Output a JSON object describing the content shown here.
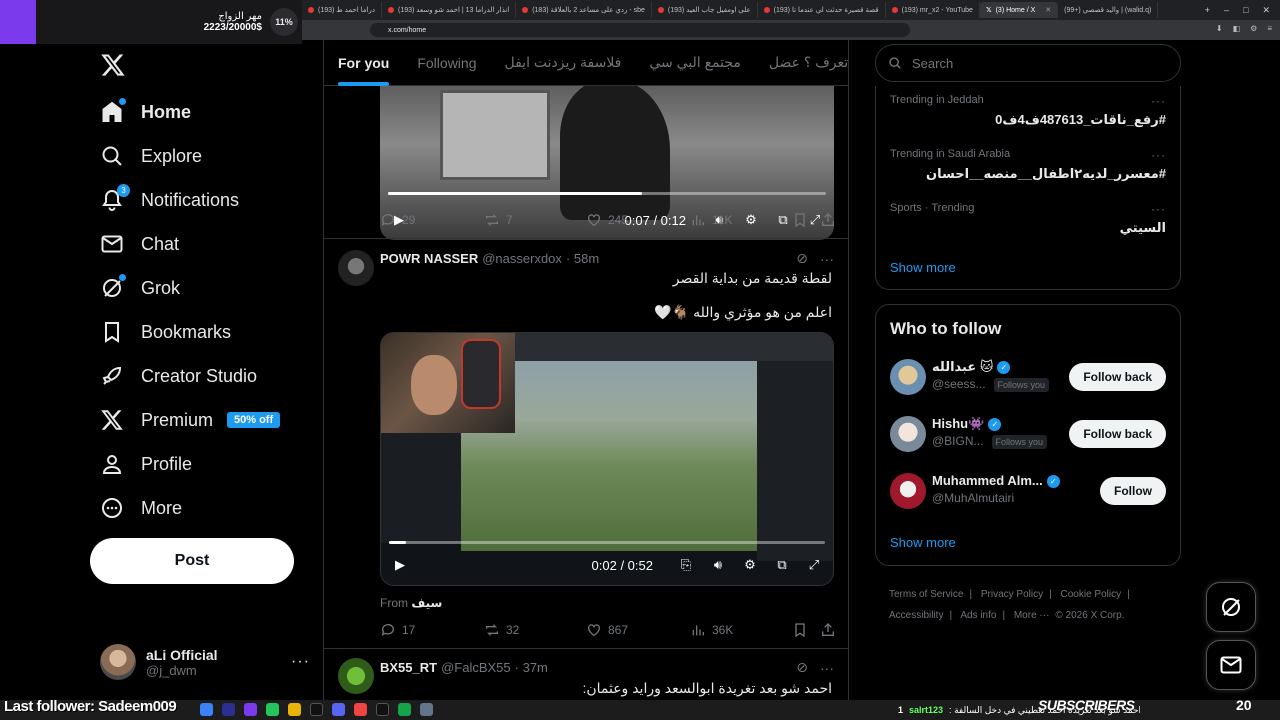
{
  "browser": {
    "tabs": [
      {
        "label": "(193) دراما احمد ط"
      },
      {
        "label": "(193) انذار الدراما 13 | احمد شو وسعد"
      },
      {
        "label": "(183) ردي على مساعد 2 بالعلاقة - sbe"
      },
      {
        "label": "(193) على اومفيل جاب العيد"
      },
      {
        "label": "(193) قصة قصيرة حدثت لي عندما تا"
      },
      {
        "label": "(193) mr_x2 - YouTube"
      },
      {
        "label": "(3) Home / X"
      },
      {
        "label": "(99+) واليد قصصي | (walid.q)"
      }
    ],
    "active_tab": "(3) Home / X",
    "url": "x.com/home"
  },
  "stream": {
    "donation_title": "مهر الزواج",
    "donation_amount": "2223/20000$",
    "donation_pct": "11%",
    "last_follower": "Last follower: Sadeem009",
    "ticker_user": "salrt123",
    "ticker_text": ": احمد شو بعد تغريدة احمد تعطيني في دخل السالفة",
    "ticker_num": "1",
    "subs_label": "SUBSCRIBERS",
    "subs_count": "20"
  },
  "nav": {
    "items": [
      {
        "label": "Home",
        "icon": "home-icon"
      },
      {
        "label": "Explore",
        "icon": "search-icon"
      },
      {
        "label": "Notifications",
        "icon": "bell-icon",
        "badge": "3"
      },
      {
        "label": "Chat",
        "icon": "mail-icon"
      },
      {
        "label": "Grok",
        "icon": "grok-icon"
      },
      {
        "label": "Bookmarks",
        "icon": "bookmark-icon"
      },
      {
        "label": "Creator Studio",
        "icon": "rocket-icon"
      },
      {
        "label": "Premium",
        "icon": "x-logo-icon",
        "pill": "50% off"
      },
      {
        "label": "Profile",
        "icon": "person-icon"
      },
      {
        "label": "More",
        "icon": "more-circle-icon"
      }
    ],
    "post_label": "Post",
    "account": {
      "name": "aLi Official",
      "handle": "@j_dwm"
    }
  },
  "feed": {
    "tabs": [
      "For you",
      "Following",
      "فلاسفة ريزدنت ايفل",
      "مجتمع البي سي",
      "هنا راح تعرف ؟ عضل"
    ],
    "tweet1": {
      "video_time": "0:07 / 0:12",
      "video_progress": 0.58,
      "replies": "29",
      "reposts": "7",
      "likes": "245",
      "views": "11K"
    },
    "tweet2": {
      "name": "POWR NASSER",
      "handle": "@nasserxdox",
      "time": "· 58m",
      "line1": "لقطة قديمة من بداية القصر",
      "line2": "اعلم من هو مؤثري والله 🐐🤍",
      "video_time": "0:02 / 0:52",
      "video_progress": 0.04,
      "from_label": "From",
      "from_name": "سيف",
      "replies": "17",
      "reposts": "32",
      "likes": "867",
      "views": "36K"
    },
    "tweet3": {
      "name": "BX55_RT",
      "handle": "@FalcBX55",
      "time": "· 37m",
      "line1": "احمد شو بعد تغريدة ابوالسعد ورايد وعثمان:"
    }
  },
  "sidebar": {
    "search_placeholder": "Search",
    "trends": [
      {
        "meta": "Trending in Jeddah",
        "name": "#رفع_ناقات_487613ف4ف0"
      },
      {
        "meta": "Trending in Saudi Arabia",
        "name": "#معسرر_لديه٢اطفال__منصه__احسان"
      },
      {
        "meta": "Sports · Trending",
        "name": "السيتي"
      }
    ],
    "show_more": "Show more",
    "wtf_title": "Who to follow",
    "wtf": [
      {
        "name": "عبدالله 🐱",
        "handle": "@seess...",
        "follows_you": "Follows you",
        "button": "Follow back"
      },
      {
        "name": "Hishu👾",
        "handle": "@BIGN...",
        "follows_you": "Follows you",
        "button": "Follow back"
      },
      {
        "name": "Muhammed Alm...",
        "handle": "@MuhAlmutairi",
        "follows_you": "",
        "button": "Follow"
      }
    ],
    "show_more2": "Show more",
    "footer": [
      "Terms of Service",
      "|",
      "Privacy Policy",
      "|",
      "Cookie Policy",
      "|",
      "Accessibility",
      "|",
      "Ads info",
      "|",
      "More ···",
      "© 2026 X Corp."
    ]
  },
  "colors": {
    "accent": "#1d9bf0",
    "bg": "#000000",
    "muted": "#71767b"
  }
}
